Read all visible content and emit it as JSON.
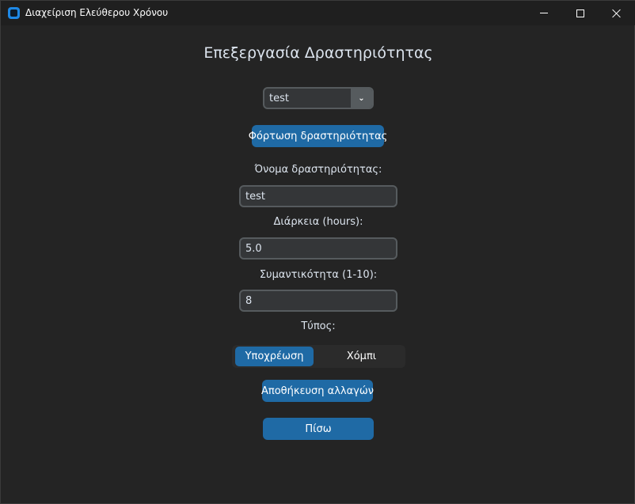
{
  "window": {
    "title": "Διαχείριση Ελεύθερου Χρόνου"
  },
  "page": {
    "heading": "Επεξεργασία Δραστηριότητας"
  },
  "activity_select": {
    "value": "test",
    "arrow_icon": "chevron-down-icon"
  },
  "buttons": {
    "load": "Φόρτωση δραστηριότητας",
    "save": "Αποθήκευση αλλαγών",
    "back": "Πίσω"
  },
  "fields": {
    "name_label": "Όνομα δραστηριότητας:",
    "name_value": "test",
    "duration_label": "Διάρκεια (hours):",
    "duration_value": "5.0",
    "importance_label": "Συμαντικότητα (1-10):",
    "importance_value": "8",
    "type_label": "Τύπος:"
  },
  "type_options": [
    {
      "label": "Υποχρέωση",
      "selected": true
    },
    {
      "label": "Χόμπι",
      "selected": false
    }
  ],
  "colors": {
    "accent": "#1f6aa5",
    "background": "#242424",
    "field_bg": "#343638",
    "field_border": "#565b5e"
  }
}
